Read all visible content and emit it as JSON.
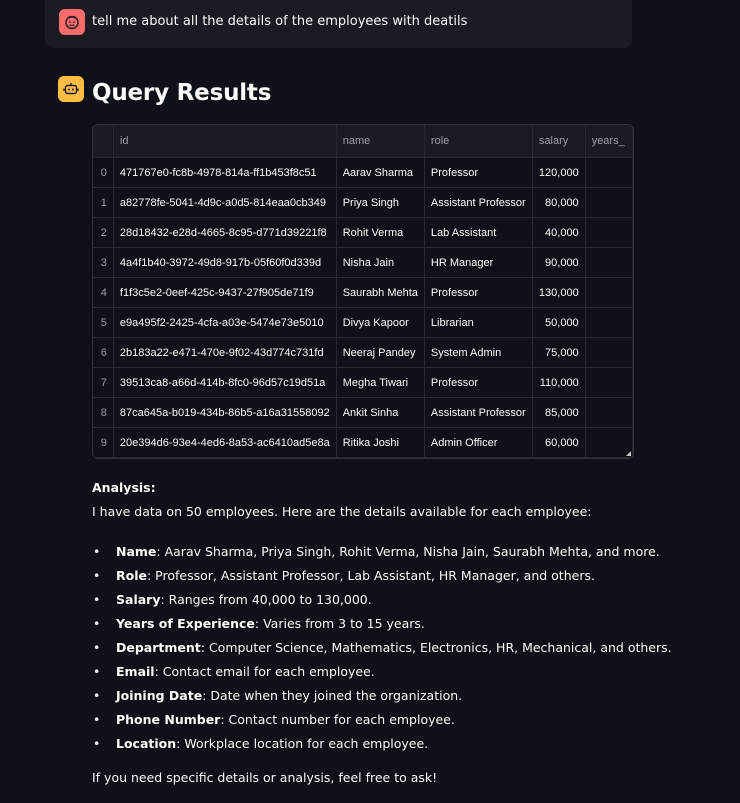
{
  "user_message": {
    "text": "tell me about all the details of the employees with deatils"
  },
  "heading": "Query Results",
  "table": {
    "columns": [
      "",
      "id",
      "name",
      "role",
      "salary",
      "years_"
    ],
    "rows": [
      {
        "index": "0",
        "id": "471767e0-fc8b-4978-814a-ff1b453f8c51",
        "name": "Aarav Sharma",
        "role": "Professor",
        "salary": "120,000"
      },
      {
        "index": "1",
        "id": "a82778fe-5041-4d9c-a0d5-814eaa0cb349",
        "name": "Priya Singh",
        "role": "Assistant Professor",
        "salary": "80,000"
      },
      {
        "index": "2",
        "id": "28d18432-e28d-4665-8c95-d771d39221f8",
        "name": "Rohit Verma",
        "role": "Lab Assistant",
        "salary": "40,000"
      },
      {
        "index": "3",
        "id": "4a4f1b40-3972-49d8-917b-05f60f0d339d",
        "name": "Nisha Jain",
        "role": "HR Manager",
        "salary": "90,000"
      },
      {
        "index": "4",
        "id": "f1f3c5e2-0eef-425c-9437-27f905de71f9",
        "name": "Saurabh Mehta",
        "role": "Professor",
        "salary": "130,000"
      },
      {
        "index": "5",
        "id": "e9a495f2-2425-4cfa-a03e-5474e73e5010",
        "name": "Divya Kapoor",
        "role": "Librarian",
        "salary": "50,000"
      },
      {
        "index": "6",
        "id": "2b183a22-e471-470e-9f02-43d774c731fd",
        "name": "Neeraj Pandey",
        "role": "System Admin",
        "salary": "75,000"
      },
      {
        "index": "7",
        "id": "39513ca8-a66d-414b-8fc0-96d57c19d51a",
        "name": "Megha Tiwari",
        "role": "Professor",
        "salary": "110,000"
      },
      {
        "index": "8",
        "id": "87ca645a-b019-434b-86b5-a16a31558092",
        "name": "Ankit Sinha",
        "role": "Assistant Professor",
        "salary": "85,000"
      },
      {
        "index": "9",
        "id": "20e394d6-93e4-4ed6-8a53-ac6410ad5e8a",
        "name": "Ritika Joshi",
        "role": "Admin Officer",
        "salary": "60,000"
      }
    ]
  },
  "analysis": {
    "title": "Analysis:",
    "intro": "I have data on 50 employees. Here are the details available for each employee:",
    "items": [
      {
        "label": "Name",
        "text": ": Aarav Sharma, Priya Singh, Rohit Verma, Nisha Jain, Saurabh Mehta, and more."
      },
      {
        "label": "Role",
        "text": ": Professor, Assistant Professor, Lab Assistant, HR Manager, and others."
      },
      {
        "label": "Salary",
        "text": ": Ranges from 40,000 to 130,000."
      },
      {
        "label": "Years of Experience",
        "text": ": Varies from 3 to 15 years."
      },
      {
        "label": "Department",
        "text": ": Computer Science, Mathematics, Electronics, HR, Mechanical, and others."
      },
      {
        "label": "Email",
        "text": ": Contact email for each employee."
      },
      {
        "label": "Joining Date",
        "text": ": Date when they joined the organization."
      },
      {
        "label": "Phone Number",
        "text": ": Contact number for each employee."
      },
      {
        "label": "Location",
        "text": ": Workplace location for each employee."
      }
    ],
    "bullet": "•",
    "closing": "If you need specific details or analysis, feel free to ask!"
  },
  "icons": {
    "user_avatar": "smiling-face-icon",
    "assistant_avatar": "robot-icon"
  },
  "colors": {
    "background": "#0e1117",
    "user_avatar": "#ff6b6b",
    "assistant_avatar": "#ffbd45"
  }
}
